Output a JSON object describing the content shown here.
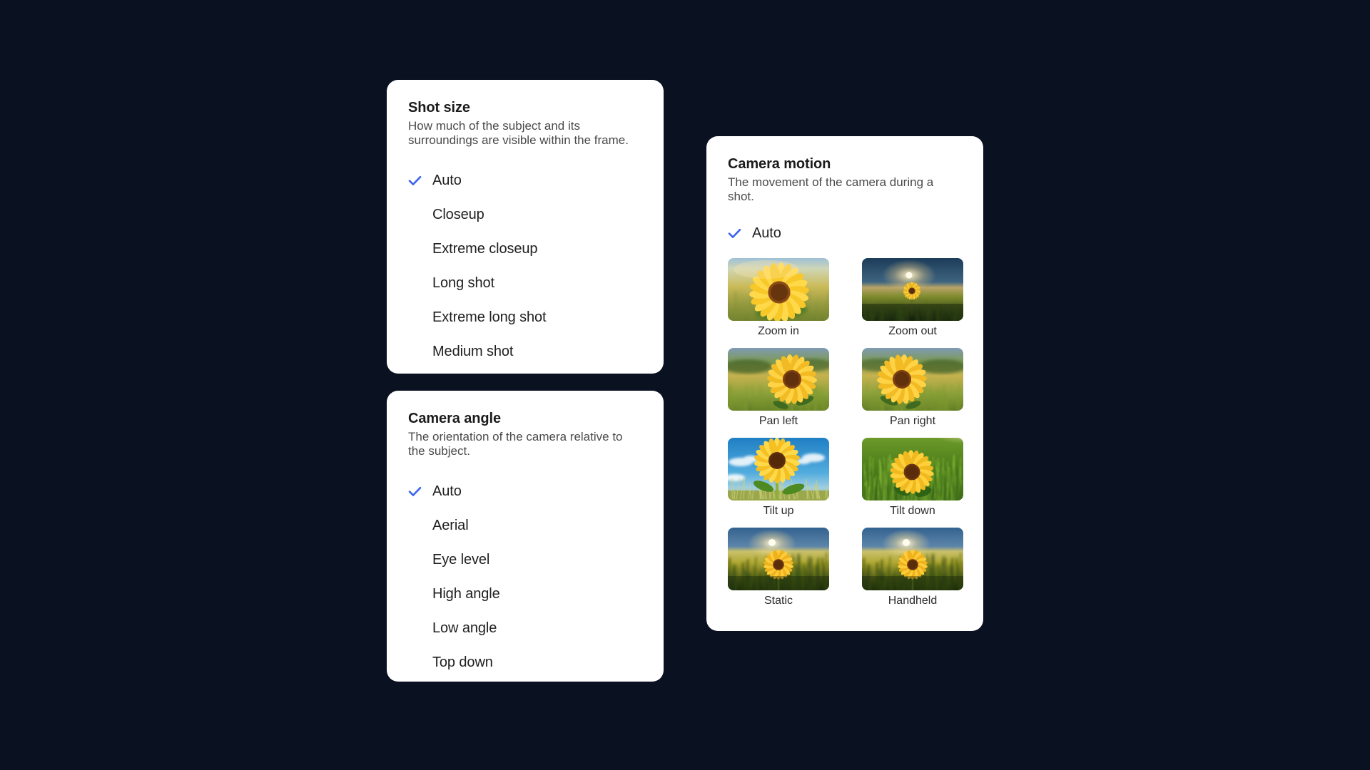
{
  "theme": {
    "background": "#0a1120",
    "card_background": "#ffffff",
    "accent_check": "#3b63f0",
    "title_color": "#1b1b1b",
    "description_color": "#4a4a4a",
    "label_color": "#1f1f1f"
  },
  "shot_size": {
    "title": "Shot size",
    "description": "How much of the subject and its surroundings are visible within the frame.",
    "options": [
      {
        "label": "Auto",
        "selected": true
      },
      {
        "label": "Closeup",
        "selected": false
      },
      {
        "label": "Extreme closeup",
        "selected": false
      },
      {
        "label": "Long shot",
        "selected": false
      },
      {
        "label": "Extreme long shot",
        "selected": false
      },
      {
        "label": "Medium shot",
        "selected": false
      }
    ]
  },
  "camera_angle": {
    "title": "Camera angle",
    "description": "The orientation of the camera relative to the subject.",
    "options": [
      {
        "label": "Auto",
        "selected": true
      },
      {
        "label": "Aerial",
        "selected": false
      },
      {
        "label": "Eye level",
        "selected": false
      },
      {
        "label": "High angle",
        "selected": false
      },
      {
        "label": "Low angle",
        "selected": false
      },
      {
        "label": "Top down",
        "selected": false
      }
    ]
  },
  "camera_motion": {
    "title": "Camera motion",
    "description": "The movement of the camera during a shot.",
    "auto_option": {
      "label": "Auto",
      "selected": true
    },
    "items": [
      {
        "label": "Zoom in",
        "scene": "closeup-sunflower"
      },
      {
        "label": "Zoom out",
        "scene": "sunset-wide-field"
      },
      {
        "label": "Pan left",
        "scene": "field-sunflower-right"
      },
      {
        "label": "Pan right",
        "scene": "field-sunflower-left"
      },
      {
        "label": "Tilt up",
        "scene": "blue-sky-sunflower"
      },
      {
        "label": "Tilt down",
        "scene": "green-grass-sunflower"
      },
      {
        "label": "Static",
        "scene": "sunset-field-center"
      },
      {
        "label": "Handheld",
        "scene": "sunset-field-center"
      }
    ]
  },
  "icons": {
    "check": "check-icon"
  }
}
